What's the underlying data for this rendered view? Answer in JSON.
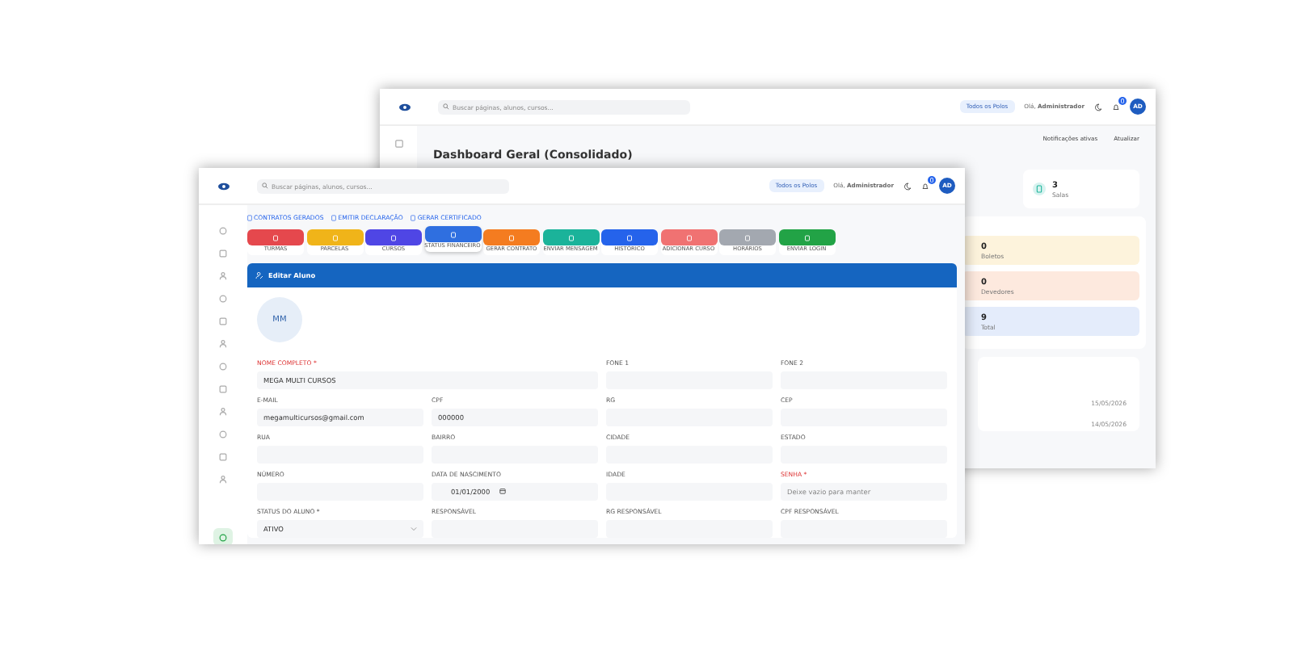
{
  "back_window": {
    "search": {
      "placeholder": "Buscar páginas, alunos, cursos..."
    },
    "polo_filter": "Todos os Polos",
    "greeting": "Olá, **Administrador**",
    "notifications_badge": "0",
    "avatar": "AD",
    "actions": [
      "Notificações ativas",
      "Atualizar"
    ],
    "title": "Dashboard Geral (Consolidado)",
    "stat": {
      "value": "3",
      "label": "Salas"
    },
    "summary": [
      {
        "value": "0",
        "label": "Boletos",
        "color": "#fdf3dc"
      },
      {
        "value": "0",
        "label": "Devedores",
        "color": "#fde9de"
      },
      {
        "value": "9",
        "label": "Total",
        "color": "#e4ecfb"
      }
    ],
    "dates": [
      "15/05/2026",
      "14/05/2026"
    ]
  },
  "front_window": {
    "search": {
      "placeholder": "Buscar páginas, alunos, cursos..."
    },
    "polo_filter": "Todos os Polos",
    "greeting": "Olá, **Administrador**",
    "notifications_badge": "0",
    "avatar": "AD",
    "sidebar": {
      "items": [
        {
          "selected": false
        },
        {
          "selected": false
        },
        {
          "selected": false
        },
        {
          "selected": false
        },
        {
          "selected": false
        },
        {
          "selected": false
        },
        {
          "selected": false
        },
        {
          "selected": false
        },
        {
          "selected": false
        },
        {
          "selected": false
        },
        {
          "selected": false
        },
        {
          "selected": false
        },
        {
          "selected": true
        }
      ]
    },
    "links": [
      "CONTRATOS GERADOS",
      "EMITIR DECLARAÇÃO",
      "GERAR CERTIFICADO"
    ],
    "actions": [
      {
        "label": "TURMAS",
        "color": "#e5484d",
        "selected": false
      },
      {
        "label": "PARCELAS",
        "color": "#f0b419",
        "selected": false
      },
      {
        "label": "CURSOS",
        "color": "#4f46e5",
        "selected": false
      },
      {
        "label": "STATUS FINANCEIRO",
        "color": "#2f6fe0",
        "selected": true
      },
      {
        "label": "GERAR CONTRATO",
        "color": "#f47c20",
        "selected": false
      },
      {
        "label": "ENVIAR MENSAGEM",
        "color": "#1bb39a",
        "selected": false
      },
      {
        "label": "HISTÓRICO",
        "color": "#2563eb",
        "selected": false
      },
      {
        "label": "ADICIONAR CURSO",
        "color": "#f07272",
        "selected": false
      },
      {
        "label": "HORÁRIOS",
        "color": "#a3a8b0",
        "selected": false
      },
      {
        "label": "ENVIAR LOGIN",
        "color": "#22a346",
        "selected": false
      }
    ],
    "panel_title": "Editar Aluno",
    "student_avatar": "MM",
    "fields": [
      {
        "label": "NOME COMPLETO *",
        "required": true,
        "kind": "text",
        "value": "MEGA MULTI CURSOS"
      },
      {
        "label": "FONE 1",
        "required": false,
        "kind": "text"
      },
      {
        "label": "FONE 2",
        "required": false,
        "kind": "text"
      },
      {
        "label": "E-MAIL",
        "required": false,
        "kind": "text",
        "value": "megamulticursos@gmail.com"
      },
      {
        "label": "CPF",
        "required": false,
        "kind": "text",
        "value": "000000"
      },
      {
        "label": "RG",
        "required": false,
        "kind": "text"
      },
      {
        "label": "CEP",
        "required": false,
        "kind": "text"
      },
      {
        "label": "RUA",
        "required": false,
        "kind": "text"
      },
      {
        "label": "BAIRRO",
        "required": false,
        "kind": "text"
      },
      {
        "label": "CIDADE",
        "required": false,
        "kind": "text"
      },
      {
        "label": "ESTADO",
        "required": false,
        "kind": "text"
      },
      {
        "label": "NÚMERO",
        "required": false,
        "kind": "text"
      },
      {
        "label": "DATA DE NASCIMENTO",
        "required": false,
        "kind": "date",
        "value": "01/01/2000"
      },
      {
        "label": "IDADE",
        "required": false,
        "kind": "text"
      },
      {
        "label": "SENHA *",
        "required": true,
        "kind": "text",
        "placeholder": "Deixe vazio para manter"
      },
      {
        "label": "STATUS DO ALUNO *",
        "required": false,
        "kind": "select",
        "value": "ATIVO"
      },
      {
        "label": "RESPONSÁVEL",
        "required": false,
        "kind": "text"
      },
      {
        "label": "RG RESPONSÁVEL",
        "required": false,
        "kind": "text"
      },
      {
        "label": "CPF RESPONSÁVEL",
        "required": false,
        "kind": "text"
      }
    ]
  }
}
